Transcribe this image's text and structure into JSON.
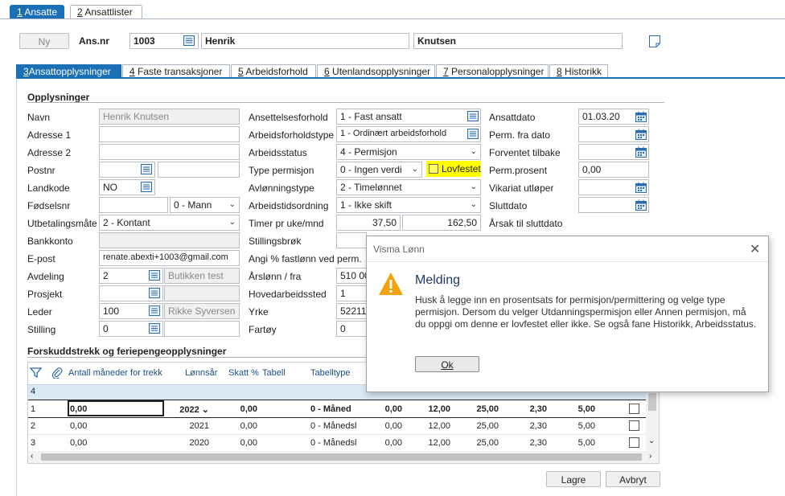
{
  "top_tabs": [
    {
      "key": "1",
      "label": "Ansatte"
    },
    {
      "key": "2",
      "label": "Ansattlister"
    }
  ],
  "header": {
    "new_label": "Ny",
    "ansnr_label": "Ans.nr",
    "ansnr_value": "1003",
    "first_name": "Henrik",
    "last_name": "Knutsen"
  },
  "sub_tabs": [
    {
      "key": "3",
      "label": "Ansattopplysninger"
    },
    {
      "key": "4",
      "label": "Faste transaksjoner"
    },
    {
      "key": "5",
      "label": "Arbeidsforhold"
    },
    {
      "key": "6",
      "label": "Utenlandsopplysninger"
    },
    {
      "key": "7",
      "label": "Personalopplysninger"
    },
    {
      "key": "8",
      "label": "Historikk"
    }
  ],
  "section1": {
    "title": "Opplysninger"
  },
  "col1": {
    "navn": {
      "label": "Navn",
      "value": "Henrik Knutsen"
    },
    "adresse1": {
      "label": "Adresse 1",
      "value": ""
    },
    "adresse2": {
      "label": "Adresse 2",
      "value": ""
    },
    "postnr": {
      "label": "Postnr",
      "value": ""
    },
    "landkode": {
      "label": "Landkode",
      "value": "NO"
    },
    "fodselsnr": {
      "label": "Fødselsnr",
      "value": "",
      "gender": "0 - Mann"
    },
    "utbetalingsmate": {
      "label": "Utbetalingsmåte",
      "value": "2 - Kontant"
    },
    "bankkonto": {
      "label": "Bankkonto",
      "value": ""
    },
    "epost": {
      "label": "E-post",
      "value": "renate.abexti+1003@gmail.com"
    },
    "avdeling": {
      "label": "Avdeling",
      "value": "2",
      "name": "Butikken test"
    },
    "prosjekt": {
      "label": "Prosjekt",
      "value": ""
    },
    "leder": {
      "label": "Leder",
      "value": "100",
      "name": "Rikke Syversen"
    },
    "stilling": {
      "label": "Stilling",
      "value": "0"
    }
  },
  "col2": {
    "ansettelsesforhold": {
      "label": "Ansettelsesforhold",
      "value": "1 - Fast ansatt"
    },
    "arbeidsforholdstype": {
      "label": "Arbeidsforholdstype",
      "value": "1 - Ordinært arbeidsforhold"
    },
    "arbeidsstatus": {
      "label": "Arbeidsstatus",
      "value": "4 - Permisjon"
    },
    "type_permisjon": {
      "label": "Type permisjon",
      "value": "0 - Ingen verdi",
      "lovfestet_label": "Lovfestet"
    },
    "avlonningstype": {
      "label": "Avlønningstype",
      "value": "2 - Timelønnet"
    },
    "arbeidstidsordning": {
      "label": "Arbeidstidsordning",
      "value": "1 - Ikke skift"
    },
    "timer": {
      "label": "Timer pr uke/mnd",
      "value1": "37,50",
      "value2": "162,50"
    },
    "stillingsbrok": {
      "label": "Stillingsbrøk"
    },
    "angi": {
      "label": "Angi % fastlønn ved perm."
    },
    "arslonn": {
      "label": "Årslønn / fra",
      "value": "510 00"
    },
    "hovedarbeidssted": {
      "label": "Hovedarbeidssted",
      "value": "1"
    },
    "yrke": {
      "label": "Yrke",
      "value": "522112"
    },
    "fartoy": {
      "label": "Fartøy",
      "value": "0"
    }
  },
  "col3": {
    "ansattdato": {
      "label": "Ansattdato",
      "value": "01.03.20"
    },
    "perm_fra": {
      "label": "Perm. fra dato",
      "value": ""
    },
    "forventet": {
      "label": "Forventet tilbake",
      "value": ""
    },
    "perm_prosent": {
      "label": "Perm.prosent",
      "value": "0,00"
    },
    "vikariat": {
      "label": "Vikariat utløper",
      "value": ""
    },
    "sluttdato": {
      "label": "Sluttdato",
      "value": ""
    },
    "arsak": {
      "label": "Årsak til sluttdato"
    }
  },
  "section2": {
    "title": "Forskuddstrekk og feriepengeopplysninger"
  },
  "grid": {
    "headers": [
      "Antall måneder for trekk",
      "Lønnsår",
      "Skatt %",
      "Tabell",
      "Tabelltype"
    ],
    "count_row": "4",
    "rows": [
      {
        "num": "1",
        "months": "0,00",
        "year": "2022",
        "skatt": "0,00",
        "tabell": "",
        "type": "0 - Måned",
        "c1": "0,00",
        "c2": "12,00",
        "c3": "25,00",
        "c4": "2,30",
        "c5": "5,00"
      },
      {
        "num": "2",
        "months": "0,00",
        "year": "2021",
        "skatt": "0,00",
        "tabell": "",
        "type": "0 - Månedsl",
        "c1": "0,00",
        "c2": "12,00",
        "c3": "25,00",
        "c4": "2,30",
        "c5": "5,00"
      },
      {
        "num": "3",
        "months": "0,00",
        "year": "2020",
        "skatt": "0,00",
        "tabell": "",
        "type": "0 - Månedsl",
        "c1": "0,00",
        "c2": "12,00",
        "c3": "25,00",
        "c4": "2,30",
        "c5": "5,00"
      }
    ]
  },
  "footer": {
    "save_label": "Lagre",
    "cancel_label": "Avbryt"
  },
  "dialog": {
    "window_title": "Visma Lønn",
    "heading": "Melding",
    "message": "Husk å legge inn en prosentsats for permisjon/permittering og velge type permisjon. Dersom du velger Utdanningspermisjon eller Annen permisjon, må du oppgi om denne er lovfestet eller ikke. Se også fane Historikk, Arbeidsstatus.",
    "ok_label": "Ok"
  },
  "colors": {
    "accent": "#1b6fb5",
    "warning": "#f0a30a",
    "highlight": "#ffff00"
  }
}
